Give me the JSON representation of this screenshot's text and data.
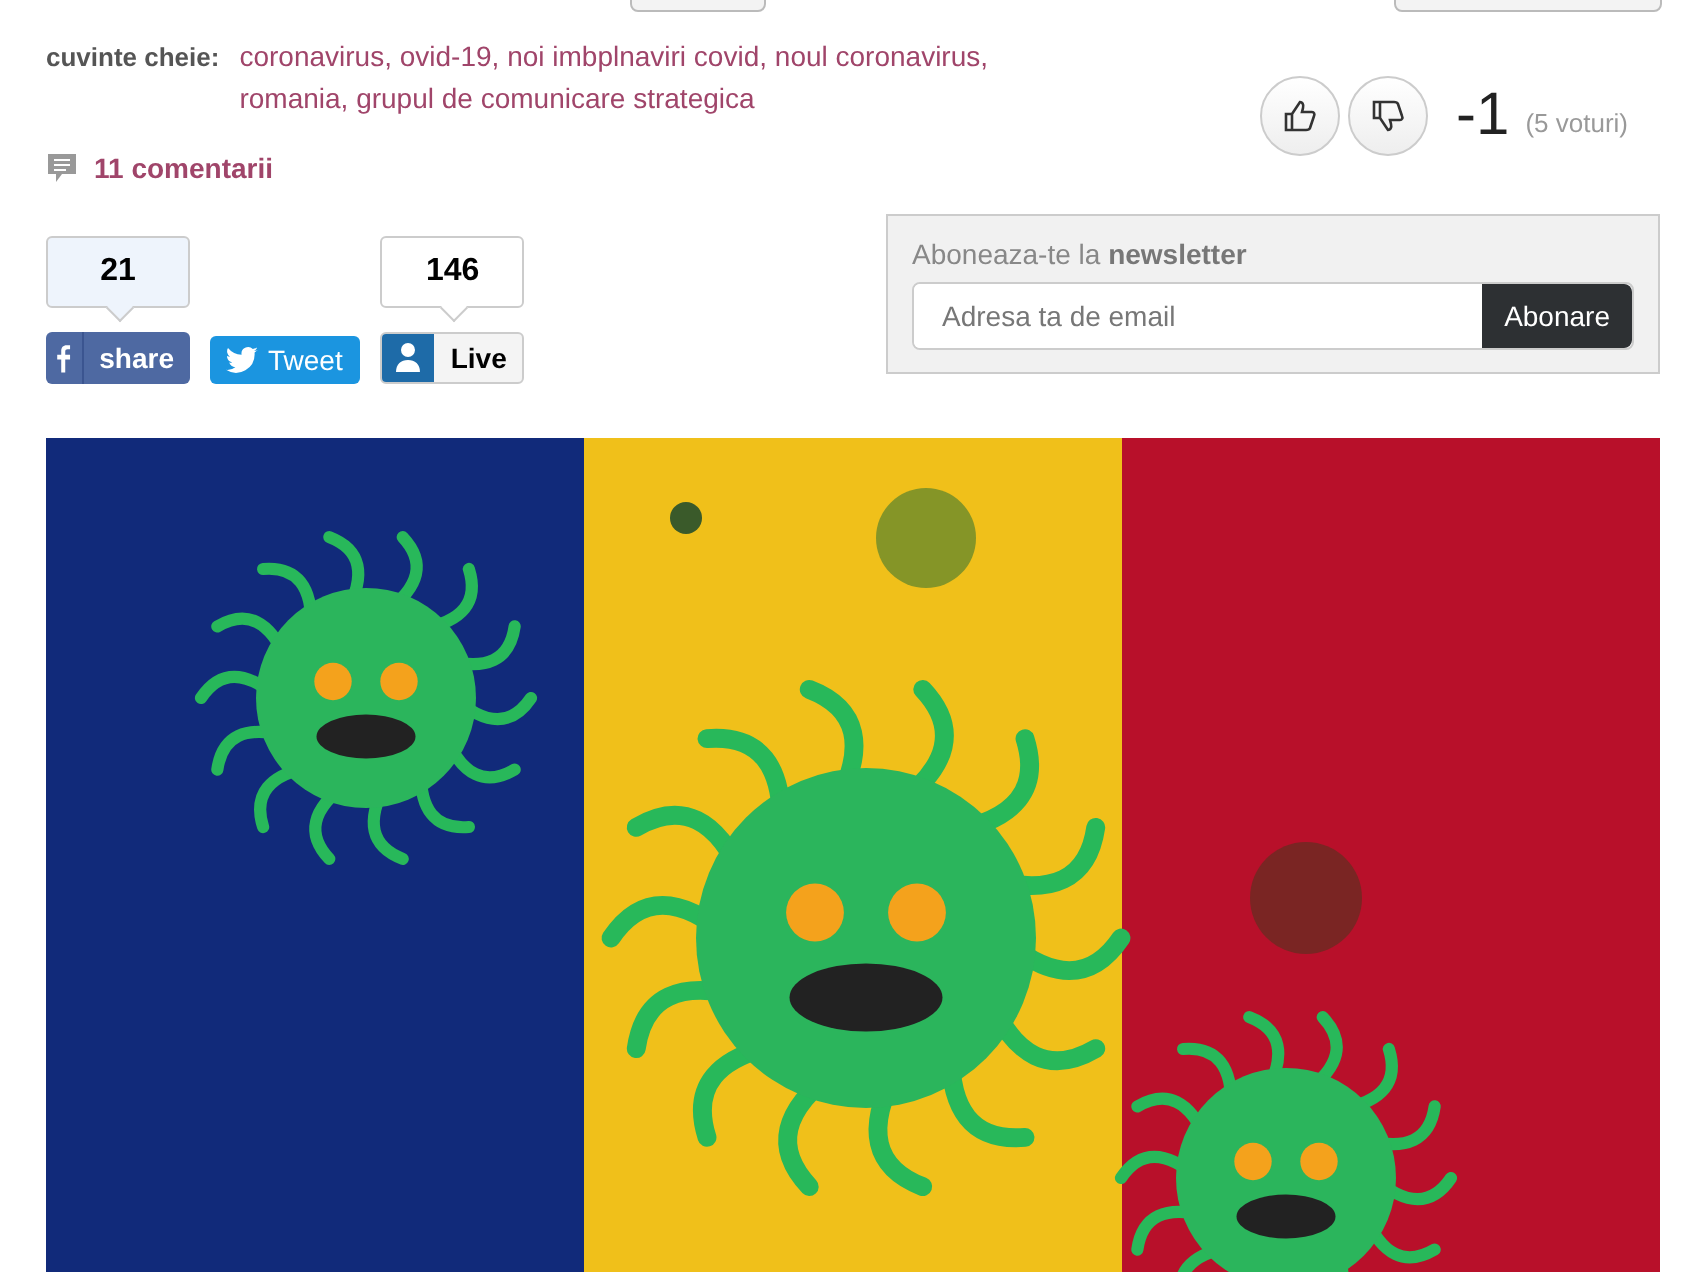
{
  "keywords": {
    "label": "cuvinte cheie:",
    "items": [
      "coronavirus,",
      "ovid-19,",
      "noi imbplnaviri covid,",
      "noul coronavirus,",
      "romania,",
      "grupul de comunicare strategica"
    ]
  },
  "votes": {
    "score": "-1",
    "count": "(5 voturi)"
  },
  "comments": {
    "label": "11 comentarii"
  },
  "social": [
    {
      "kind": "facebook",
      "count": "21",
      "label": "share"
    },
    {
      "kind": "twitter",
      "label": "Tweet"
    },
    {
      "kind": "live",
      "count": "146",
      "label": "Live"
    }
  ],
  "newsletter": {
    "title": "Aboneaza-te la **newsletter**",
    "placeholder": "Adresa ta de email",
    "button": "Abonare"
  }
}
